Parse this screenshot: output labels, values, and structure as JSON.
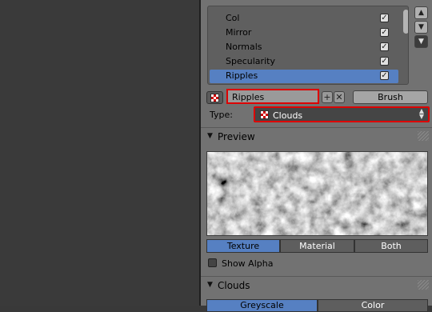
{
  "texture_slots": [
    {
      "label": "Col",
      "checked": true,
      "active": false
    },
    {
      "label": "Mirror",
      "checked": true,
      "active": false
    },
    {
      "label": "Normals",
      "checked": true,
      "active": false
    },
    {
      "label": "Specularity",
      "checked": true,
      "active": false
    },
    {
      "label": "Ripples",
      "checked": true,
      "active": true
    }
  ],
  "texture": {
    "name": "Ripples",
    "brush_label": "Brush",
    "type_label": "Type:",
    "type_value": "Clouds"
  },
  "preview_panel": {
    "title": "Preview",
    "tabs": [
      "Texture",
      "Material",
      "Both"
    ],
    "active_tab": "Texture",
    "show_alpha_label": "Show Alpha",
    "show_alpha_checked": false
  },
  "clouds_panel": {
    "title": "Clouds",
    "tabs": [
      "Greyscale",
      "Color"
    ]
  },
  "colors": {
    "accent": "#5680c2",
    "highlight_border": "#dd0000",
    "panel_bg": "#727272"
  },
  "icons": {
    "texture": "checker-texture-icon",
    "add": "plus-icon",
    "remove": "x-icon",
    "collapse": "triangle-down-icon"
  }
}
